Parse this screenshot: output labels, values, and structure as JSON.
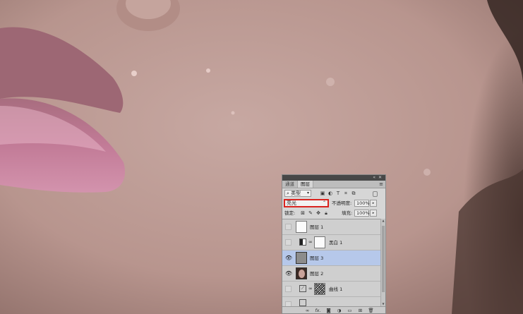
{
  "panel": {
    "window_controls": "«  ✕",
    "tabs": [
      {
        "label": "通道",
        "active": false
      },
      {
        "label": "图层",
        "active": true
      }
    ],
    "menu_icon": "≡",
    "filter": {
      "search_icon": "⌕",
      "label": "类型",
      "arrow": "▾"
    },
    "blend_mode": {
      "value": "亮光",
      "arrow": "⌃",
      "highlight_color": "#d9241f"
    },
    "opacity": {
      "label": "不透明度:",
      "value": "100%",
      "stepper": "▸"
    },
    "lock": {
      "label": "锁定:"
    },
    "fill": {
      "label": "填充:",
      "value": "100%",
      "stepper": "▸"
    },
    "layers": [
      {
        "name": "图层 1",
        "visible": false,
        "selected": false,
        "thumb": "white"
      },
      {
        "name": "黑白 1",
        "visible": false,
        "selected": false,
        "thumb": "white",
        "adjustment": "black-white"
      },
      {
        "name": "图层 3",
        "visible": true,
        "selected": true,
        "thumb": "gray"
      },
      {
        "name": "图层 2",
        "visible": true,
        "selected": false,
        "thumb": "photo"
      },
      {
        "name": "曲线 1",
        "visible": false,
        "selected": false,
        "thumb": "noise",
        "adjustment": "curves"
      }
    ],
    "bottom_icons": [
      "link-layers-icon",
      "fx-icon",
      "add-mask-icon",
      "adjustment-layer-icon",
      "group-folder-icon",
      "new-layer-icon",
      "trash-icon"
    ],
    "fx_label": "fx.",
    "selection_color": "#b6c8ea"
  }
}
